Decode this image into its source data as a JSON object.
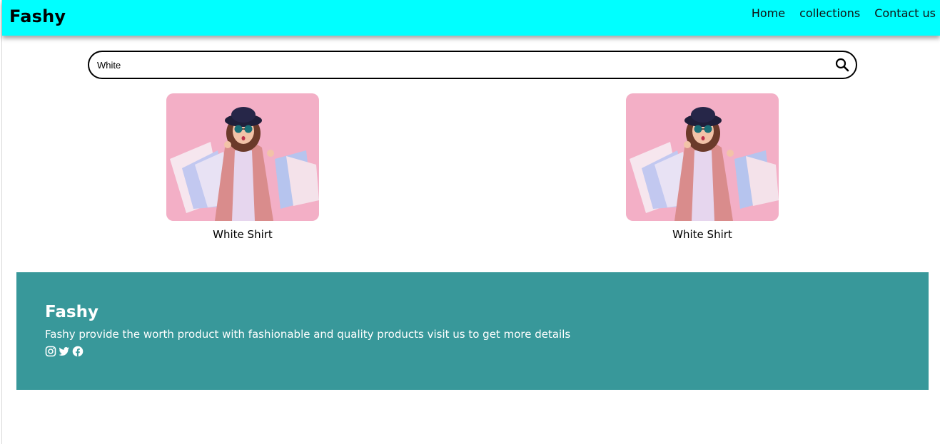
{
  "navbar": {
    "brand": "Fashy",
    "links": [
      "Home",
      "collections",
      "Contact us"
    ]
  },
  "search": {
    "value": "White",
    "icon": "search-icon"
  },
  "products": [
    {
      "title": "White Shirt",
      "image": "woman-with-shopping-bags"
    },
    {
      "title": "White Shirt",
      "image": "woman-with-shopping-bags"
    }
  ],
  "footer": {
    "title": "Fashy",
    "description": "Fashy provide the worth product with fashionable and quality products visit us to get more details",
    "social_icons": [
      "instagram-icon",
      "twitter-icon",
      "facebook-icon"
    ]
  },
  "colors": {
    "navbar_bg": "#00ffff",
    "footer_bg": "#38989a",
    "image_bg": "#f2a7c0"
  }
}
